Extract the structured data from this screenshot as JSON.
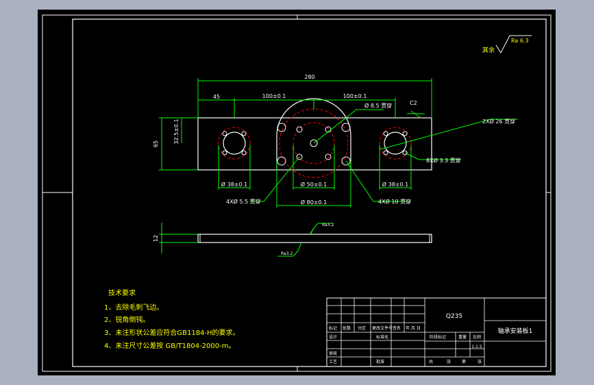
{
  "colors": {
    "background": "#a9b1c0",
    "paper": "#000000",
    "frame": "#ffffff",
    "dimension": "#00ff00",
    "hidden": "#ff0000",
    "note": "#ffff00"
  },
  "roughness": {
    "prefix": "其余",
    "value": "Ra 6.3",
    "top_surface": "Ra3.2",
    "bottom_surface": "Ra3.2"
  },
  "dims": {
    "overall_length": "280",
    "left_offset": "45",
    "span_left": "100±0.1",
    "span_right": "100±0.1",
    "height_total": "65",
    "height_half": "32.5±0.1",
    "chamfer": "C2",
    "center_holes": "Ø 8.5 贯穿",
    "bearing_bore": "2XØ 26 贯穿",
    "small_holes": "8XØ 3.3 贯穿",
    "left_circle": "Ø 38±0.1",
    "center_circle": "Ø 50±0.1",
    "right_circle": "Ø 38±0.1",
    "outer_circle": "Ø 80±0.1",
    "left_four_holes": "4XØ 5.5 贯穿",
    "right_four_holes": "4XØ 10 贯穿",
    "thickness": "12"
  },
  "tech_requirements": {
    "title": "技术要求",
    "items": [
      "1、去除毛刺飞边。",
      "2、锐角倒钝。",
      "3、未注形状公差应符合GB1184-H的要求。",
      "4、未注尺寸公差按 GB/T1804-2000-m。"
    ]
  },
  "title_block": {
    "material": "Q235",
    "part_name": "轴承安装板1",
    "scale": "1:1.5",
    "labels": {
      "mark": "标记",
      "count": "处数",
      "zone": "分区",
      "change_doc": "更改文件号",
      "signature": "签名",
      "date": "年.月.日",
      "design": "设计",
      "standardize": "标准化",
      "stage_mark": "阶段标记",
      "weight": "重量",
      "ratio": "比例",
      "review": "审核",
      "process": "工艺",
      "approve": "批准",
      "total": "共",
      "sheet": "张",
      "number": "第"
    }
  }
}
